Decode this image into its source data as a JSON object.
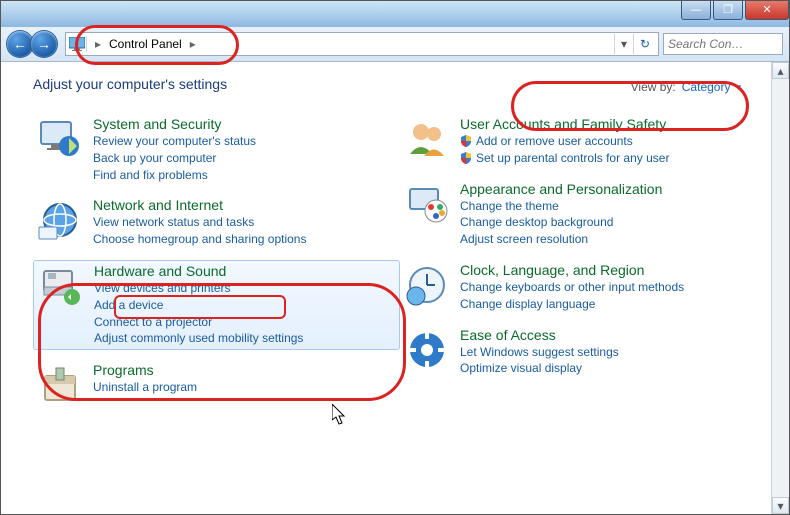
{
  "titlebar": {
    "minimize": "—",
    "maximize": "❐",
    "close": "✕"
  },
  "nav": {
    "back_glyph": "←",
    "fwd_glyph": "→",
    "crumb": "Control Panel",
    "crumb_arrow": "▸",
    "drop": "▾",
    "refresh": "↻"
  },
  "search": {
    "placeholder": "Search Con…"
  },
  "header": {
    "title": "Adjust your computer's settings",
    "viewby_label": "View by:",
    "viewby_value": "Category",
    "viewby_tri": "▾"
  },
  "categories": {
    "left": [
      {
        "title": "System and Security",
        "links": [
          {
            "text": "Review your computer's status"
          },
          {
            "text": "Back up your computer"
          },
          {
            "text": "Find and fix problems"
          }
        ]
      },
      {
        "title": "Network and Internet",
        "links": [
          {
            "text": "View network status and tasks"
          },
          {
            "text": "Choose homegroup and sharing options"
          }
        ]
      },
      {
        "title": "Hardware and Sound",
        "hover": true,
        "links": [
          {
            "text": "View devices and printers"
          },
          {
            "text": "Add a device"
          },
          {
            "text": "Connect to a projector"
          },
          {
            "text": "Adjust commonly used mobility settings"
          }
        ]
      },
      {
        "title": "Programs",
        "links": [
          {
            "text": "Uninstall a program"
          }
        ]
      }
    ],
    "right": [
      {
        "title": "User Accounts and Family Safety",
        "links": [
          {
            "text": "Add or remove user accounts",
            "shield": true
          },
          {
            "text": "Set up parental controls for any user",
            "shield": true
          }
        ]
      },
      {
        "title": "Appearance and Personalization",
        "links": [
          {
            "text": "Change the theme"
          },
          {
            "text": "Change desktop background"
          },
          {
            "text": "Adjust screen resolution"
          }
        ]
      },
      {
        "title": "Clock, Language, and Region",
        "links": [
          {
            "text": "Change keyboards or other input methods"
          },
          {
            "text": "Change display language"
          }
        ]
      },
      {
        "title": "Ease of Access",
        "links": [
          {
            "text": "Let Windows suggest settings"
          },
          {
            "text": "Optimize visual display"
          }
        ]
      }
    ]
  },
  "icons": {
    "system": "🖥️",
    "network": "🌐",
    "hardware": "🖨️",
    "programs": "📦",
    "users": "👥",
    "appearance": "🎨",
    "clock": "🕒",
    "ease": "⚙️"
  }
}
